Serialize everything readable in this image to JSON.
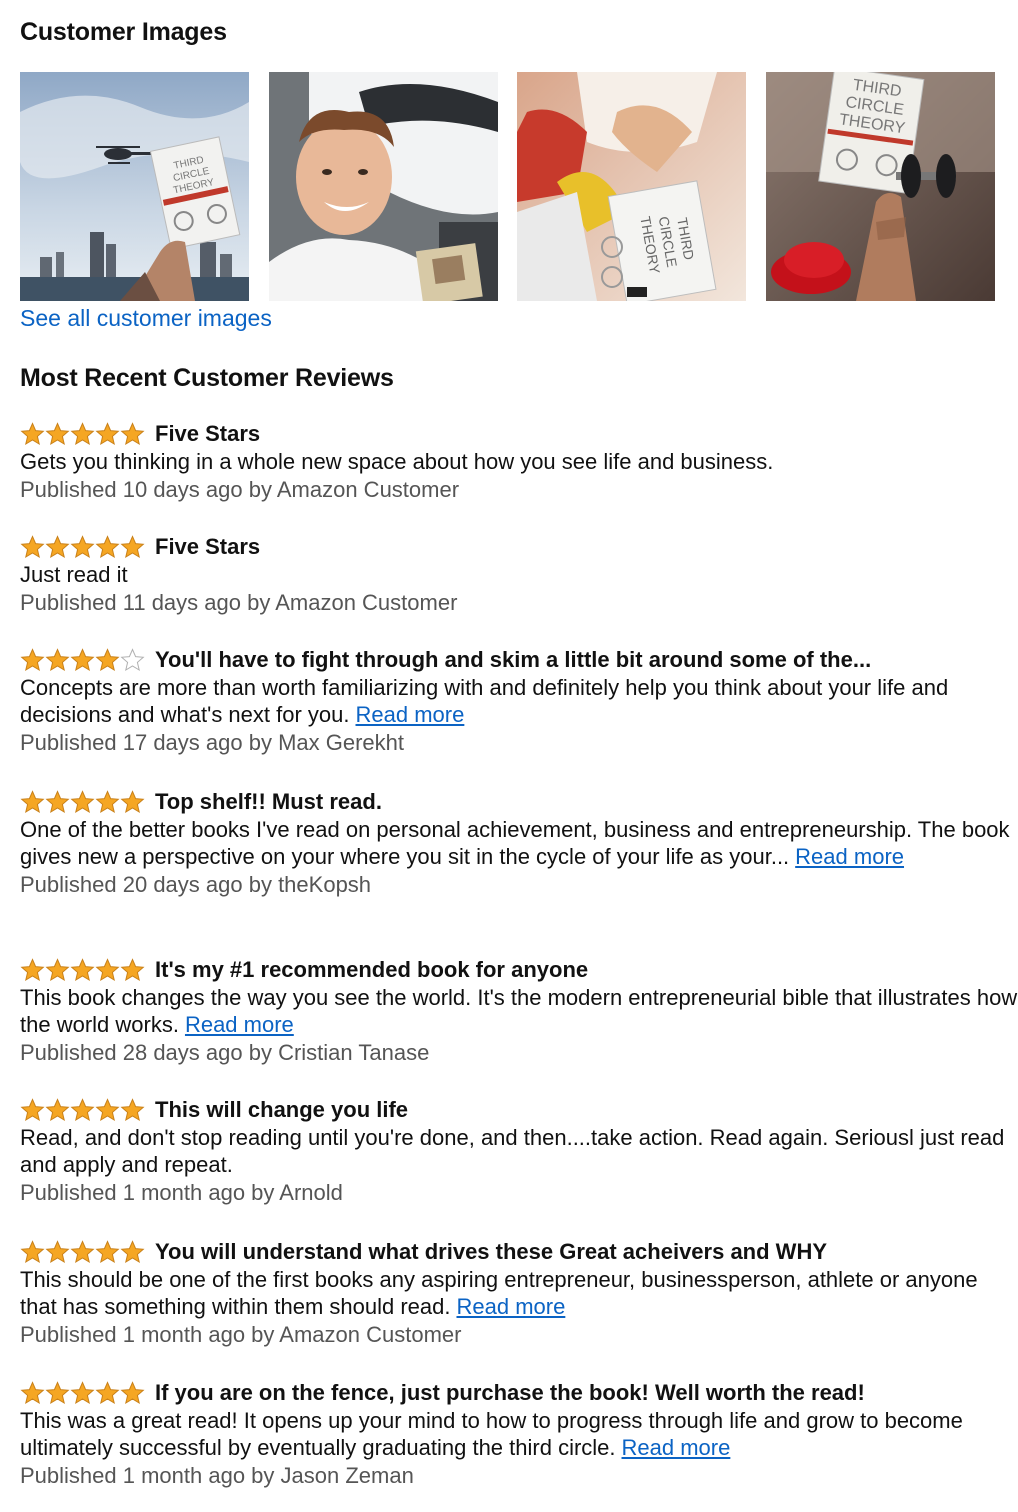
{
  "customer_images": {
    "title": "Customer Images",
    "see_all_label": "See all customer images",
    "images": [
      {
        "name": "helicopter-city-book-photo",
        "cover_text": "THIRD CIRCLE THEORY"
      },
      {
        "name": "man-with-car-book-photo",
        "cover_text": ""
      },
      {
        "name": "book-on-lap-photo",
        "cover_text": "THIRD CIRCLE THEORY"
      },
      {
        "name": "book-with-dumbbell-photo",
        "cover_text": "THIRD CIRCLE THEORY"
      }
    ]
  },
  "reviews_section": {
    "title": "Most Recent Customer Reviews",
    "read_more_label": "Read more",
    "star_color": "#f5a623",
    "reviews": [
      {
        "rating": 5,
        "title": "Five Stars",
        "body": "Gets you thinking in a whole new space about how you see life and business.",
        "read_more": false,
        "meta": "Published 10 days ago by Amazon Customer"
      },
      {
        "rating": 5,
        "title": "Five Stars",
        "body": "Just read it",
        "read_more": false,
        "meta": "Published 11 days ago by Amazon Customer"
      },
      {
        "rating": 4,
        "title": "You'll have to fight through and skim a little bit around some of the...",
        "body": "Concepts are more than worth familiarizing with and definitely help you think about your life and decisions and what's next for you.",
        "read_more": true,
        "meta": "Published 17 days ago by Max Gerekht"
      },
      {
        "rating": 5,
        "title": "Top shelf!! Must read.",
        "body": "One of the better books I've read on personal achievement, business and entrepreneurship. The book gives new a perspective on your where you sit in the cycle of your life as your...",
        "read_more": true,
        "meta": "Published 20 days ago by theKopsh"
      },
      {
        "rating": 5,
        "title": "It's my #1 recommended book for anyone",
        "body": "This book changes the way you see the world. It's the modern entrepreneurial bible that illustrates how the world works.",
        "read_more": true,
        "meta": "Published 28 days ago by Cristian Tanase"
      },
      {
        "rating": 5,
        "title": "This will change you life",
        "body": "Read, and don't stop reading until you're done, and then....take action. Read again. Seriousl just read and apply and repeat.",
        "read_more": false,
        "meta": "Published 1 month ago by Arnold"
      },
      {
        "rating": 5,
        "title": "You will understand what drives these Great acheivers and WHY",
        "body": "This should be one of the first books any aspiring entrepreneur, businessperson, athlete or anyone that has something within them should read.",
        "read_more": true,
        "meta": "Published 1 month ago by Amazon Customer"
      },
      {
        "rating": 5,
        "title": "If you are on the fence, just purchase the book! Well worth the read!",
        "body": "This was a great read! It opens up your mind to how to progress through life and grow to become ultimately successful by eventually graduating the third circle.",
        "read_more": true,
        "meta": "Published 1 month ago by Jason Zeman"
      }
    ]
  }
}
